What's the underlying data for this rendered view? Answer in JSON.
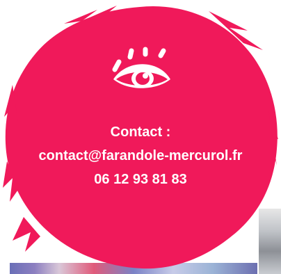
{
  "contact": {
    "heading": "Contact :",
    "email": "contact@farandole-mercurol.fr",
    "phone": "06 12 93 81 83"
  },
  "icons": {
    "eye": "eye-icon"
  },
  "colors": {
    "accent": "#F0195A",
    "text": "#FFFFFF"
  }
}
